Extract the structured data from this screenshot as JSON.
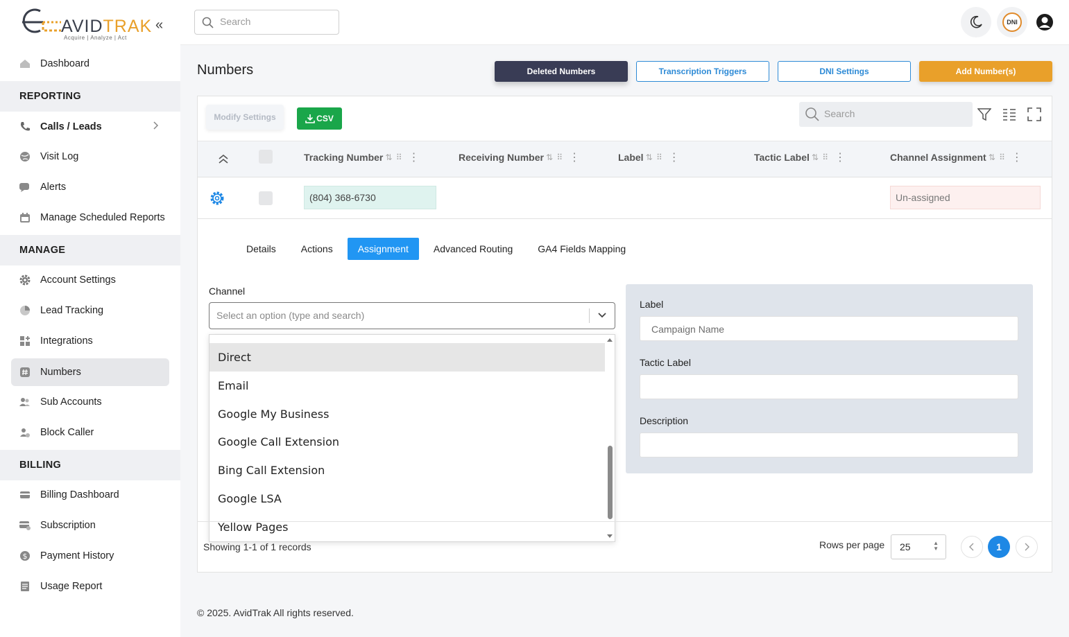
{
  "brand": {
    "name_left": "AVID",
    "name_right": "TRAK",
    "tagline": "Acquire  |  Analyze  |  Act"
  },
  "sidebar": {
    "items": [
      {
        "label": "Dashboard"
      },
      {
        "label": "Calls / Leads"
      },
      {
        "label": "Visit Log"
      },
      {
        "label": "Alerts"
      },
      {
        "label": "Manage Scheduled Reports"
      },
      {
        "label": "Account Settings"
      },
      {
        "label": "Lead Tracking"
      },
      {
        "label": "Integrations"
      },
      {
        "label": "Numbers"
      },
      {
        "label": "Sub Accounts"
      },
      {
        "label": "Block Caller"
      },
      {
        "label": "Billing Dashboard"
      },
      {
        "label": "Subscription"
      },
      {
        "label": "Payment History"
      },
      {
        "label": "Usage Report"
      }
    ],
    "sections": {
      "reporting": "REPORTING",
      "manage": "MANAGE",
      "billing": "BILLING"
    },
    "active": "Numbers"
  },
  "header": {
    "search_placeholder": "Search",
    "dni_badge": "DNI"
  },
  "page": {
    "title": "Numbers",
    "buttons": {
      "deleted": "Deleted Numbers",
      "transcription": "Transcription Triggers",
      "dni": "DNI Settings",
      "add": "Add Number(s)"
    }
  },
  "toolbar": {
    "modify": "Modify Settings",
    "csv": "CSV",
    "search_placeholder": "Search"
  },
  "table": {
    "columns": [
      "Tracking Number",
      "Receiving Number",
      "Label",
      "Tactic Label",
      "Channel Assignment"
    ],
    "rows": [
      {
        "tracking_number": "(804) 368-6730",
        "receiving_number": "",
        "label": "",
        "tactic_label": "",
        "channel_assignment": "Un-assigned"
      }
    ]
  },
  "detail": {
    "tabs": [
      "Details",
      "Actions",
      "Assignment",
      "Advanced Routing",
      "GA4 Fields Mapping"
    ],
    "active_tab": "Assignment",
    "channel": {
      "label": "Channel",
      "placeholder": "Select an option (type and search)",
      "options": [
        "Direct",
        "Email",
        "Google My Business",
        "Google Call Extension",
        "Bing Call Extension",
        "Google LSA",
        "Yellow Pages"
      ],
      "hovered": "Direct"
    },
    "right": {
      "label_title": "Label",
      "label_placeholder": "Campaign Name",
      "tactic_title": "Tactic Label",
      "description_title": "Description"
    }
  },
  "pagination": {
    "showing": "Showing 1-1 of 1 records",
    "rows_label": "Rows per page",
    "rows_value": "25",
    "current_page": "1"
  },
  "footer": {
    "copyright": "© 2025. AvidTrak All rights reserved."
  },
  "colors": {
    "accent_orange": "#e9a02a",
    "primary_blue": "#2196f3",
    "dark_button": "#393c55",
    "csv_green": "#1aa64a"
  }
}
